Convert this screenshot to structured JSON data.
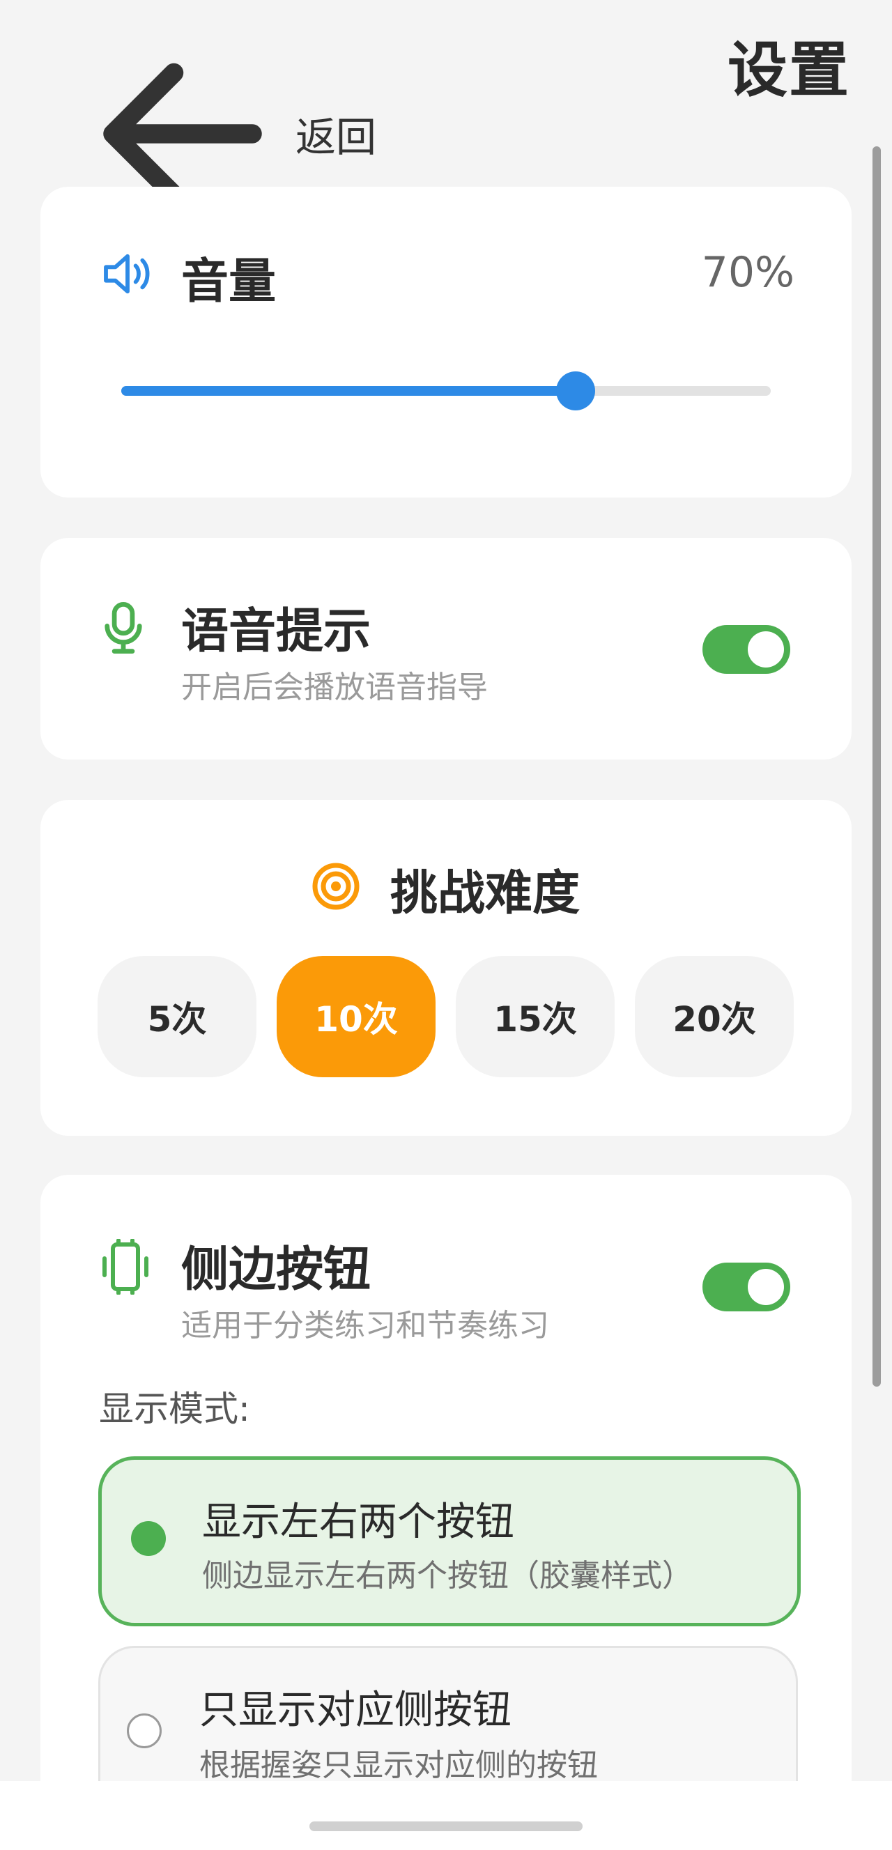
{
  "header": {
    "back_label": "返回",
    "title": "设置"
  },
  "volume": {
    "label": "音量",
    "percent_text": "70%",
    "level": 0.7,
    "accent": "#2d8ae6",
    "icon": "speaker-icon"
  },
  "voice_prompt": {
    "label": "语音提示",
    "subtitle": "开启后会播放语音指导",
    "enabled": true,
    "icon": "microphone-icon"
  },
  "difficulty": {
    "title": "挑战难度",
    "icon": "target-icon",
    "options": [
      "5次",
      "10次",
      "15次",
      "20次"
    ],
    "selected_index": 1,
    "accent": "#fb9a08"
  },
  "side_buttons": {
    "label": "侧边按钮",
    "subtitle": "适用于分类练习和节奏练习",
    "enabled": true,
    "icon": "side-button-icon",
    "mode_label": "显示模式:",
    "modes": [
      {
        "title": "显示左右两个按钮",
        "subtitle": "侧边显示左右两个按钮（胶囊样式）",
        "selected": true
      },
      {
        "title": "只显示对应侧按钮",
        "subtitle": "根据握姿只显示对应侧的按钮",
        "selected": false
      }
    ]
  },
  "colors": {
    "toggle_on": "#4caf50",
    "background": "#f4f4f4"
  }
}
